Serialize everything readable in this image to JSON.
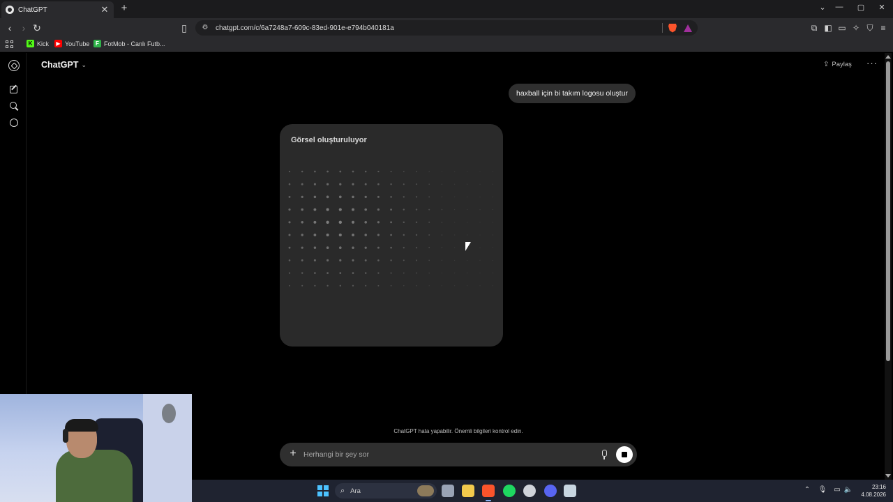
{
  "browser": {
    "tab_title": "ChatGPT",
    "tab_close": "✕",
    "new_tab": "+",
    "window_controls": [
      "⌄",
      "—",
      "▢",
      "✕"
    ],
    "url": "chatgpt.com/c/6a7248a7-609c-83ed-901e-e794b040181a",
    "bookmarks": [
      {
        "label": "Kick",
        "icon": "kick-icon",
        "color": "#53fc18"
      },
      {
        "label": "YouTube",
        "icon": "youtube-icon",
        "color": "#ff0000"
      },
      {
        "label": "FotMob - Canlı Futb...",
        "icon": "fotmob-icon",
        "color": "#2fb34a"
      }
    ]
  },
  "chat": {
    "model_name": "ChatGPT",
    "share_label": "Paylaş",
    "more_label": "···",
    "user_message": "haxball için bi takım logosu oluştur",
    "generating_label": "Görsel oluşturuluyor",
    "disclaimer": "ChatGPT hata yapabilir. Önemli bilgileri kontrol edin.",
    "composer_placeholder": "Herhangi bir şey sor"
  },
  "taskbar": {
    "search_placeholder": "Ara",
    "clock_time": "23:16",
    "clock_date": "4.08.2026",
    "apps": [
      {
        "name": "task-view-icon",
        "color": "#9aa3b5"
      },
      {
        "name": "file-explorer-icon",
        "color": "#f2c94c"
      },
      {
        "name": "brave-browser-icon",
        "color": "#fb542b"
      },
      {
        "name": "spotify-icon",
        "color": "#1ed760"
      },
      {
        "name": "obs-icon",
        "color": "#cfd3da"
      },
      {
        "name": "discord-icon",
        "color": "#5865f2"
      },
      {
        "name": "steam-icon",
        "color": "#c7d5e0"
      }
    ]
  },
  "colors": {
    "page_bg": "#000000",
    "bubble_bg": "#2f2f2f",
    "card_bg": "#2a2a2a",
    "accent_windows": "#4cc2ff"
  }
}
